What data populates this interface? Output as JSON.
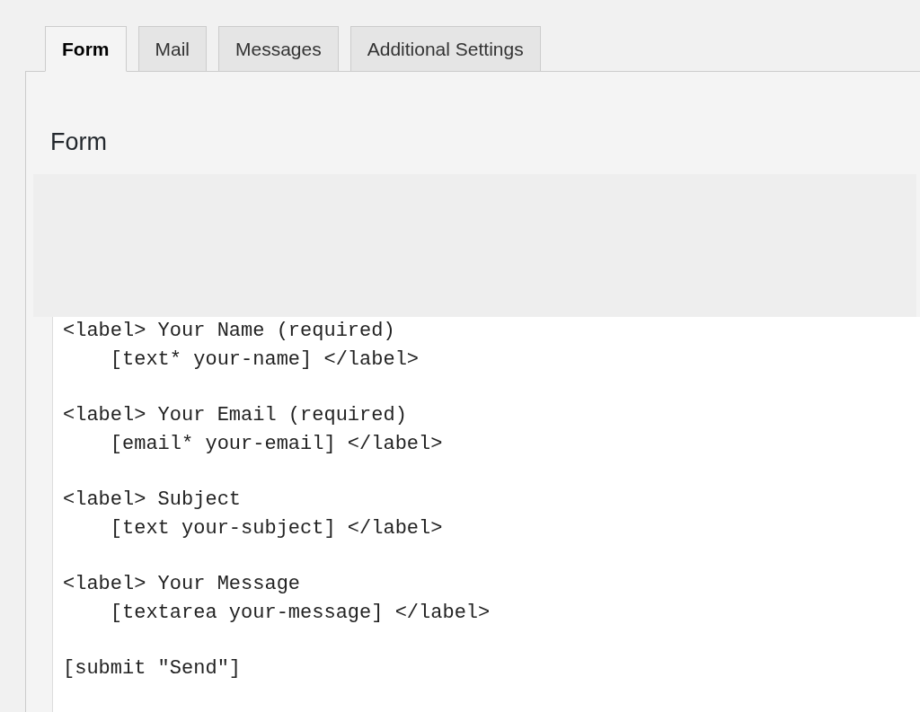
{
  "tabs": [
    {
      "label": "Form",
      "selected": true
    },
    {
      "label": "Mail",
      "selected": false
    },
    {
      "label": "Messages",
      "selected": false
    },
    {
      "label": "Additional Settings",
      "selected": false
    }
  ],
  "panel": {
    "title": "Form"
  },
  "template": [
    [
      "<label> Your Name (required)",
      "    [text* your-name] </label>"
    ],
    [
      "<label> Your Email (required)",
      "    [email* your-email] </label>"
    ],
    [
      "<label> Subject",
      "    [text your-subject] </label>"
    ],
    [
      "<label> Your Message",
      "    [textarea your-message] </label>"
    ],
    [
      "[submit \"Send\"]"
    ]
  ]
}
